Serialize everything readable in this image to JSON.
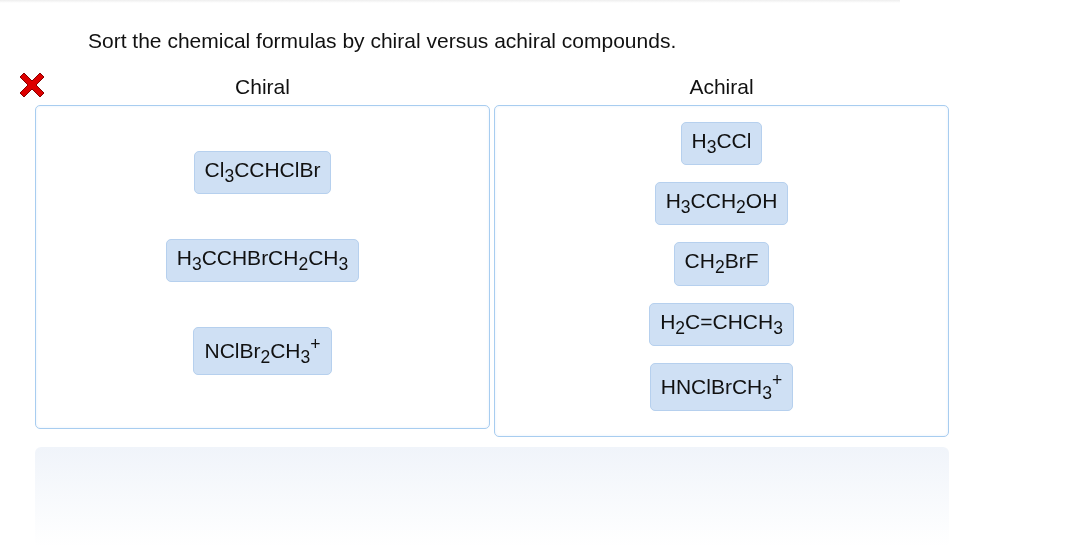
{
  "prompt": "Sort the chemical formulas by chiral versus achiral compounds.",
  "answer_correct": false,
  "bins": [
    {
      "label": "Chiral",
      "items": [
        "Cl$_{3}$CCHClBr",
        "H$_{3}$CCHBrCH$_{2}$CH$_{3}$",
        "NClBr$_{2}$CH$_{3}$$^{+}$"
      ]
    },
    {
      "label": "Achiral",
      "items": [
        "H$_{3}$CCl",
        "H$_{3}$CCH$_{2}$OH",
        "CH$_{2}$BrF",
        "H$_{2}$C=CHCH$_{3}$",
        "HNClBrCH$_{3}$$^{+}$"
      ]
    }
  ]
}
